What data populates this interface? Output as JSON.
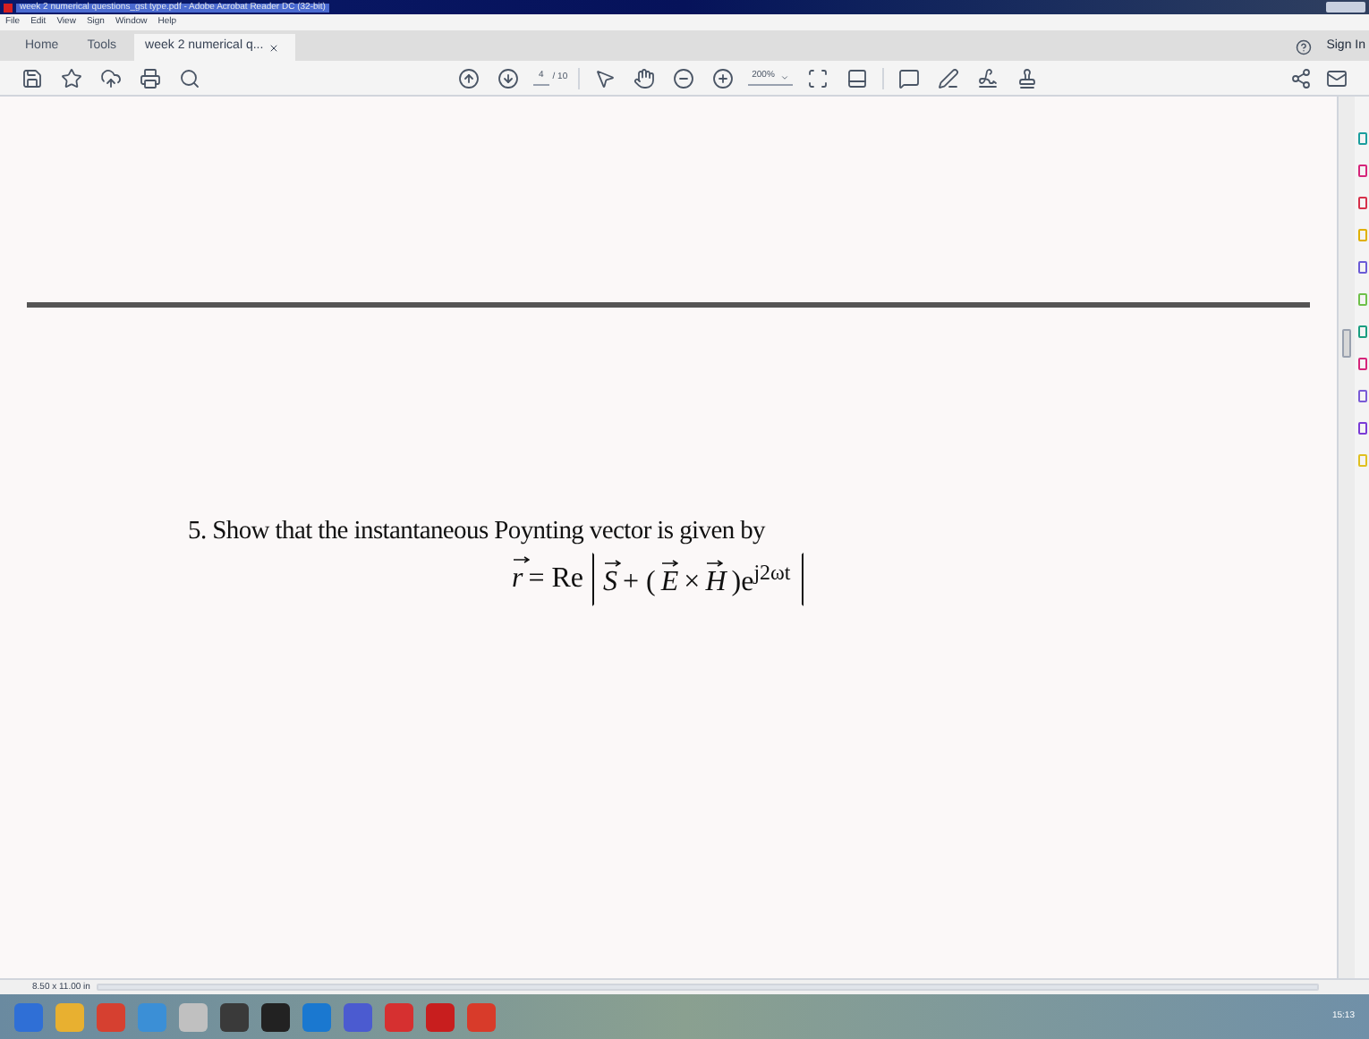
{
  "window": {
    "title": "week 2 numerical questions_gst type.pdf - Adobe Acrobat Reader DC (32-bit)"
  },
  "menu": [
    "File",
    "Edit",
    "View",
    "Sign",
    "Window",
    "Help"
  ],
  "tabs": [
    {
      "label": "Home",
      "selected": false,
      "closable": false
    },
    {
      "label": "Tools",
      "selected": false,
      "closable": false
    },
    {
      "label": "week 2 numerical q...",
      "selected": true,
      "closable": true
    }
  ],
  "sign_in": "Sign In",
  "page_nav": {
    "current": "4",
    "total": "/ 10"
  },
  "zoom": "200%",
  "document": {
    "question": "5. Show that the instantaneous Poynting vector is given by",
    "formula_left": [
      {
        "text": "r",
        "vector": true
      },
      {
        "text": "= Re",
        "vector": false
      }
    ],
    "formula_inner": [
      {
        "text": "S",
        "vector": true
      },
      {
        "text": "+ (",
        "vector": false
      },
      {
        "text": "E",
        "vector": true
      },
      {
        "text": "×",
        "vector": false
      },
      {
        "text": "H",
        "vector": true
      },
      {
        "text": ")e$^{j2ωt}$",
        "vector": false
      }
    ]
  },
  "status_bar": {
    "page_size": "8.50 x 11.00 in"
  },
  "taskbar": {
    "time": "15:13"
  }
}
